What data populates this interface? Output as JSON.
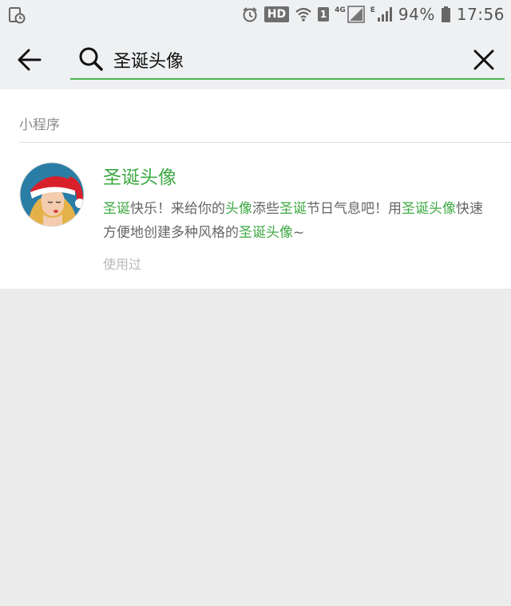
{
  "status_bar": {
    "left_icon": "app-clock-notification-icon",
    "icons": [
      "alarm-icon",
      "wifi-icon",
      "signal-icon"
    ],
    "hd_label": "HD",
    "sim_label": "1",
    "network_4g": "4G",
    "network_e": "E",
    "battery_percent": "94%",
    "time": "17:56"
  },
  "search": {
    "query": "圣诞头像",
    "accent_color": "#49b350"
  },
  "results": {
    "section_title": "小程序",
    "items": [
      {
        "title": "圣诞头像",
        "description_segments": [
          {
            "text": "圣诞",
            "highlight": true
          },
          {
            "text": "快乐！来给你的",
            "highlight": false
          },
          {
            "text": "头像",
            "highlight": true
          },
          {
            "text": "添些",
            "highlight": false
          },
          {
            "text": "圣诞",
            "highlight": true
          },
          {
            "text": "节日气息吧！用",
            "highlight": false
          },
          {
            "text": "圣诞头像",
            "highlight": true
          },
          {
            "text": "快速方便地创建多种风格的",
            "highlight": false
          },
          {
            "text": "圣诞头像",
            "highlight": true
          },
          {
            "text": "~",
            "highlight": false
          }
        ],
        "meta": "使用过",
        "avatar_icon": "santa-hat-girl-avatar"
      }
    ]
  },
  "colors": {
    "highlight": "#3ea944",
    "background": "#ececec",
    "header_bg": "#eef0f2"
  }
}
